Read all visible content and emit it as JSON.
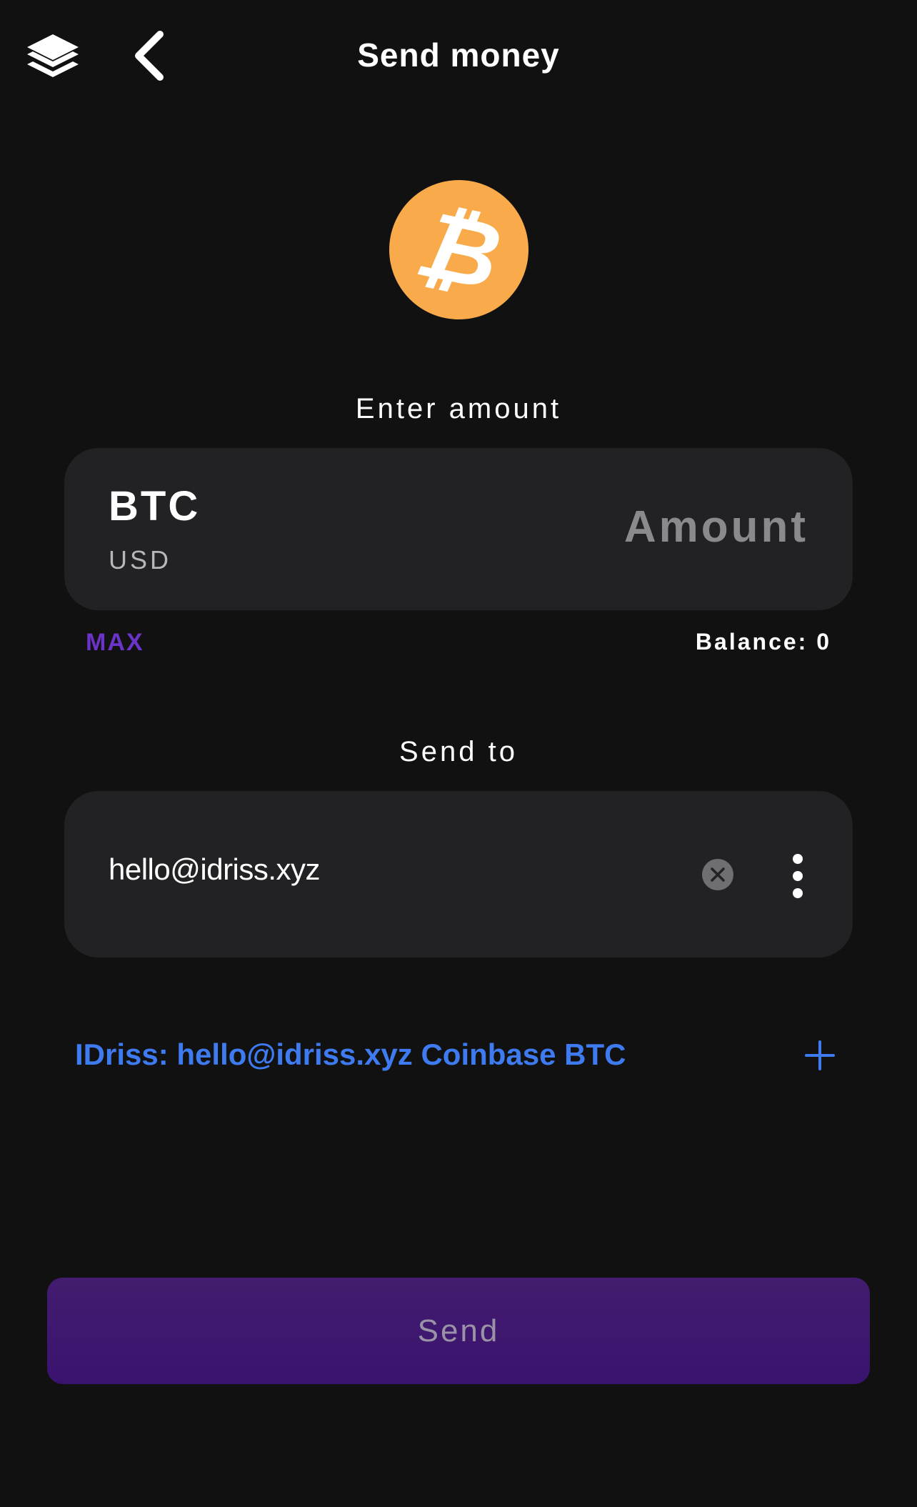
{
  "header": {
    "title": "Send money",
    "left_icon": "layers-icon",
    "back_icon": "chevron-left-icon"
  },
  "coin": {
    "icon": "bitcoin-icon",
    "glyph": "₿",
    "color": "#F9AA4B"
  },
  "amount_section": {
    "label": "Enter amount",
    "currency_primary": "BTC",
    "currency_secondary": "USD",
    "amount_placeholder": "Amount",
    "amount_value": "",
    "max_label": "MAX",
    "balance_text": "Balance: 0"
  },
  "recipient_section": {
    "label": "Send to",
    "value": "hello@idriss.xyz",
    "clear_icon": "clear-circle-icon",
    "more_icon": "more-vertical-icon"
  },
  "suggestion": {
    "text": "IDriss: hello@idriss.xyz Coinbase BTC",
    "icon": "plus-icon"
  },
  "actions": {
    "send_label": "Send"
  },
  "colors": {
    "background": "#111112",
    "card": "#222224",
    "accent_purple": "#6b34c9",
    "link_blue": "#3f7bf0",
    "button": "#431c6f"
  }
}
